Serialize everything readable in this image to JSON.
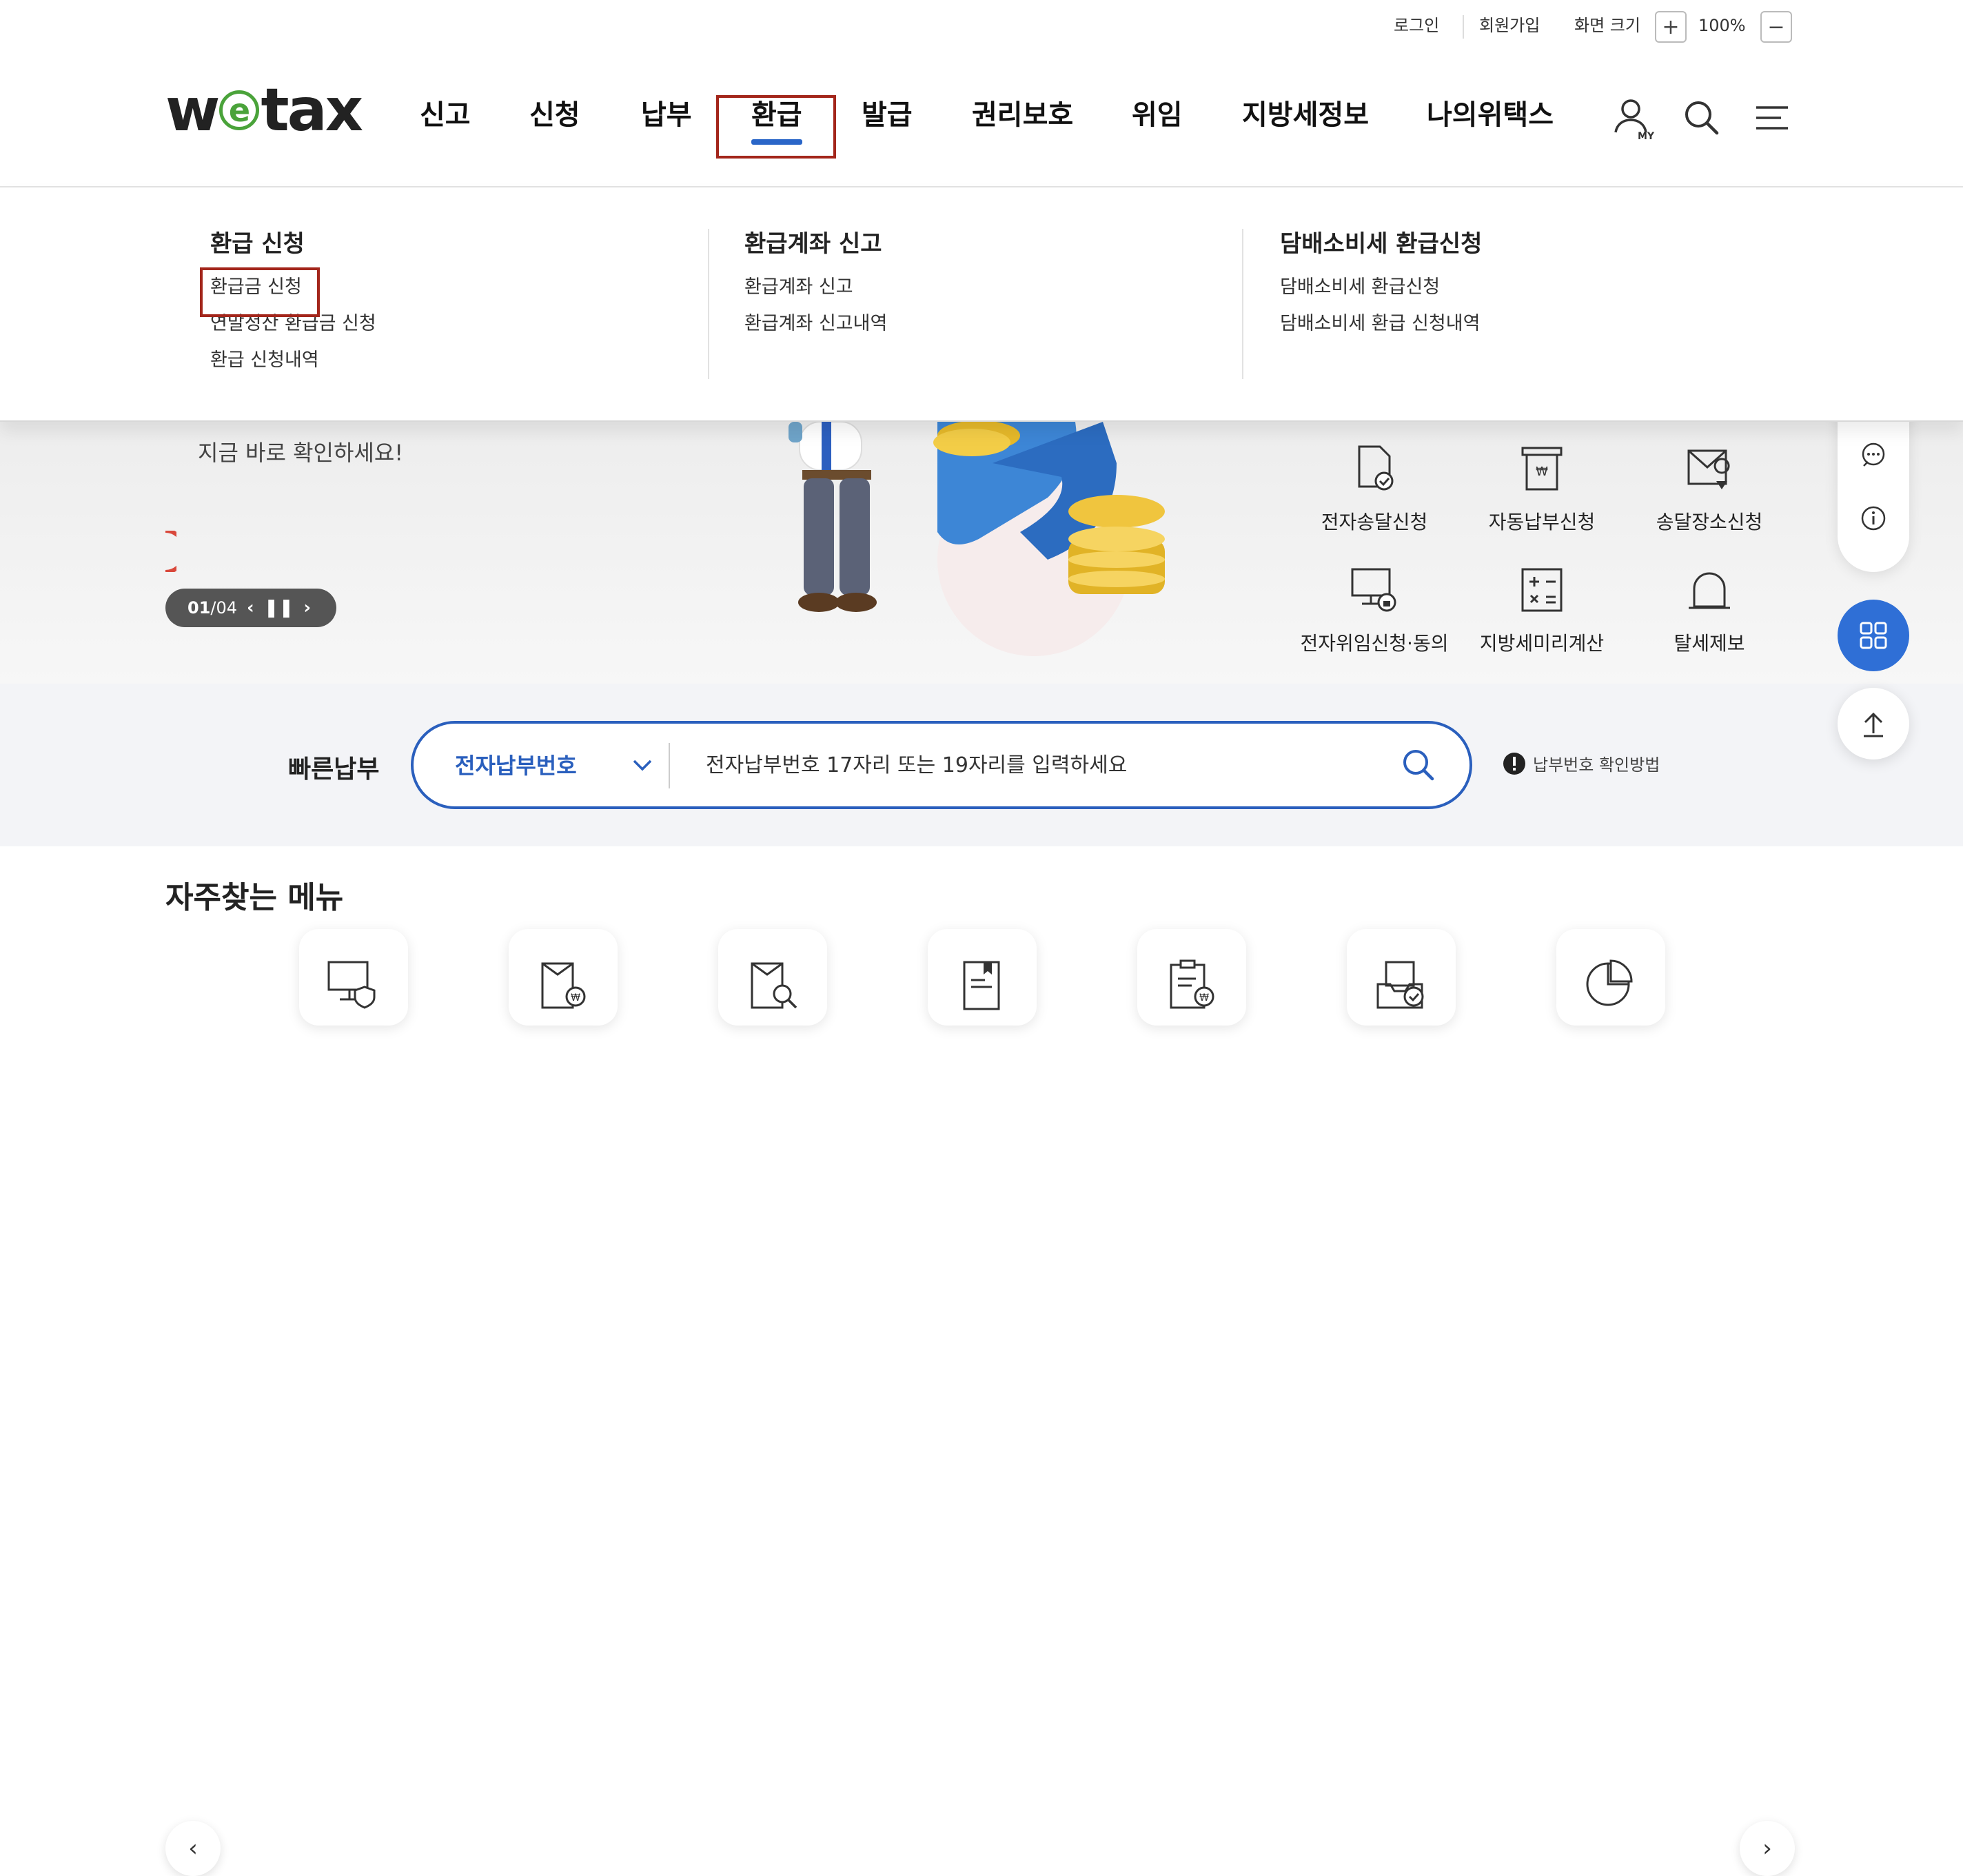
{
  "util": {
    "login": "로그인",
    "signup": "회원가입",
    "screen_size_label": "화면 크기",
    "zoom_in": "+",
    "zoom_level": "100%",
    "zoom_out": "−"
  },
  "logo": {
    "pre": "w",
    "e": "e",
    "post": "tax"
  },
  "gnb": [
    "신고",
    "신청",
    "납부",
    "환급",
    "발급",
    "권리보호",
    "위임",
    "지방세정보",
    "나의위택스"
  ],
  "gnb_active": "환급",
  "dropdown": {
    "columns": [
      {
        "title": "환급 신청",
        "items": [
          "환급금 신청",
          "연말정산 환급금 신청",
          "환급 신청내역"
        ]
      },
      {
        "title": "환급계좌 신고",
        "items": [
          "환급계좌 신고",
          "환급계좌 신고내역"
        ]
      },
      {
        "title": "담배소비세 환급신청",
        "items": [
          "담배소비세 환급신청",
          "담배소비세 환급 신청내역"
        ]
      }
    ]
  },
  "banner": {
    "text": "지금 바로 확인하세요!",
    "pager_current": "01",
    "pager_sep": "/",
    "pager_total": "04"
  },
  "services": [
    "전자송달신청",
    "자동납부신청",
    "송달장소신청",
    "전자위임신청·동의",
    "지방세미리계산",
    "탈세제보"
  ],
  "quick_pay": {
    "title": "빠른납부",
    "select_value": "전자납부번호",
    "placeholder": "전자납부번호 17자리 또는 19자리를 입력하세요",
    "help": "납부번호 확인방법"
  },
  "frequent": {
    "title": "자주찾는 메뉴"
  },
  "colors": {
    "accent": "#2a5fbd",
    "highlight_box": "#a3261b",
    "fab": "#2f6fd6",
    "logo_green": "#4aa33a"
  }
}
